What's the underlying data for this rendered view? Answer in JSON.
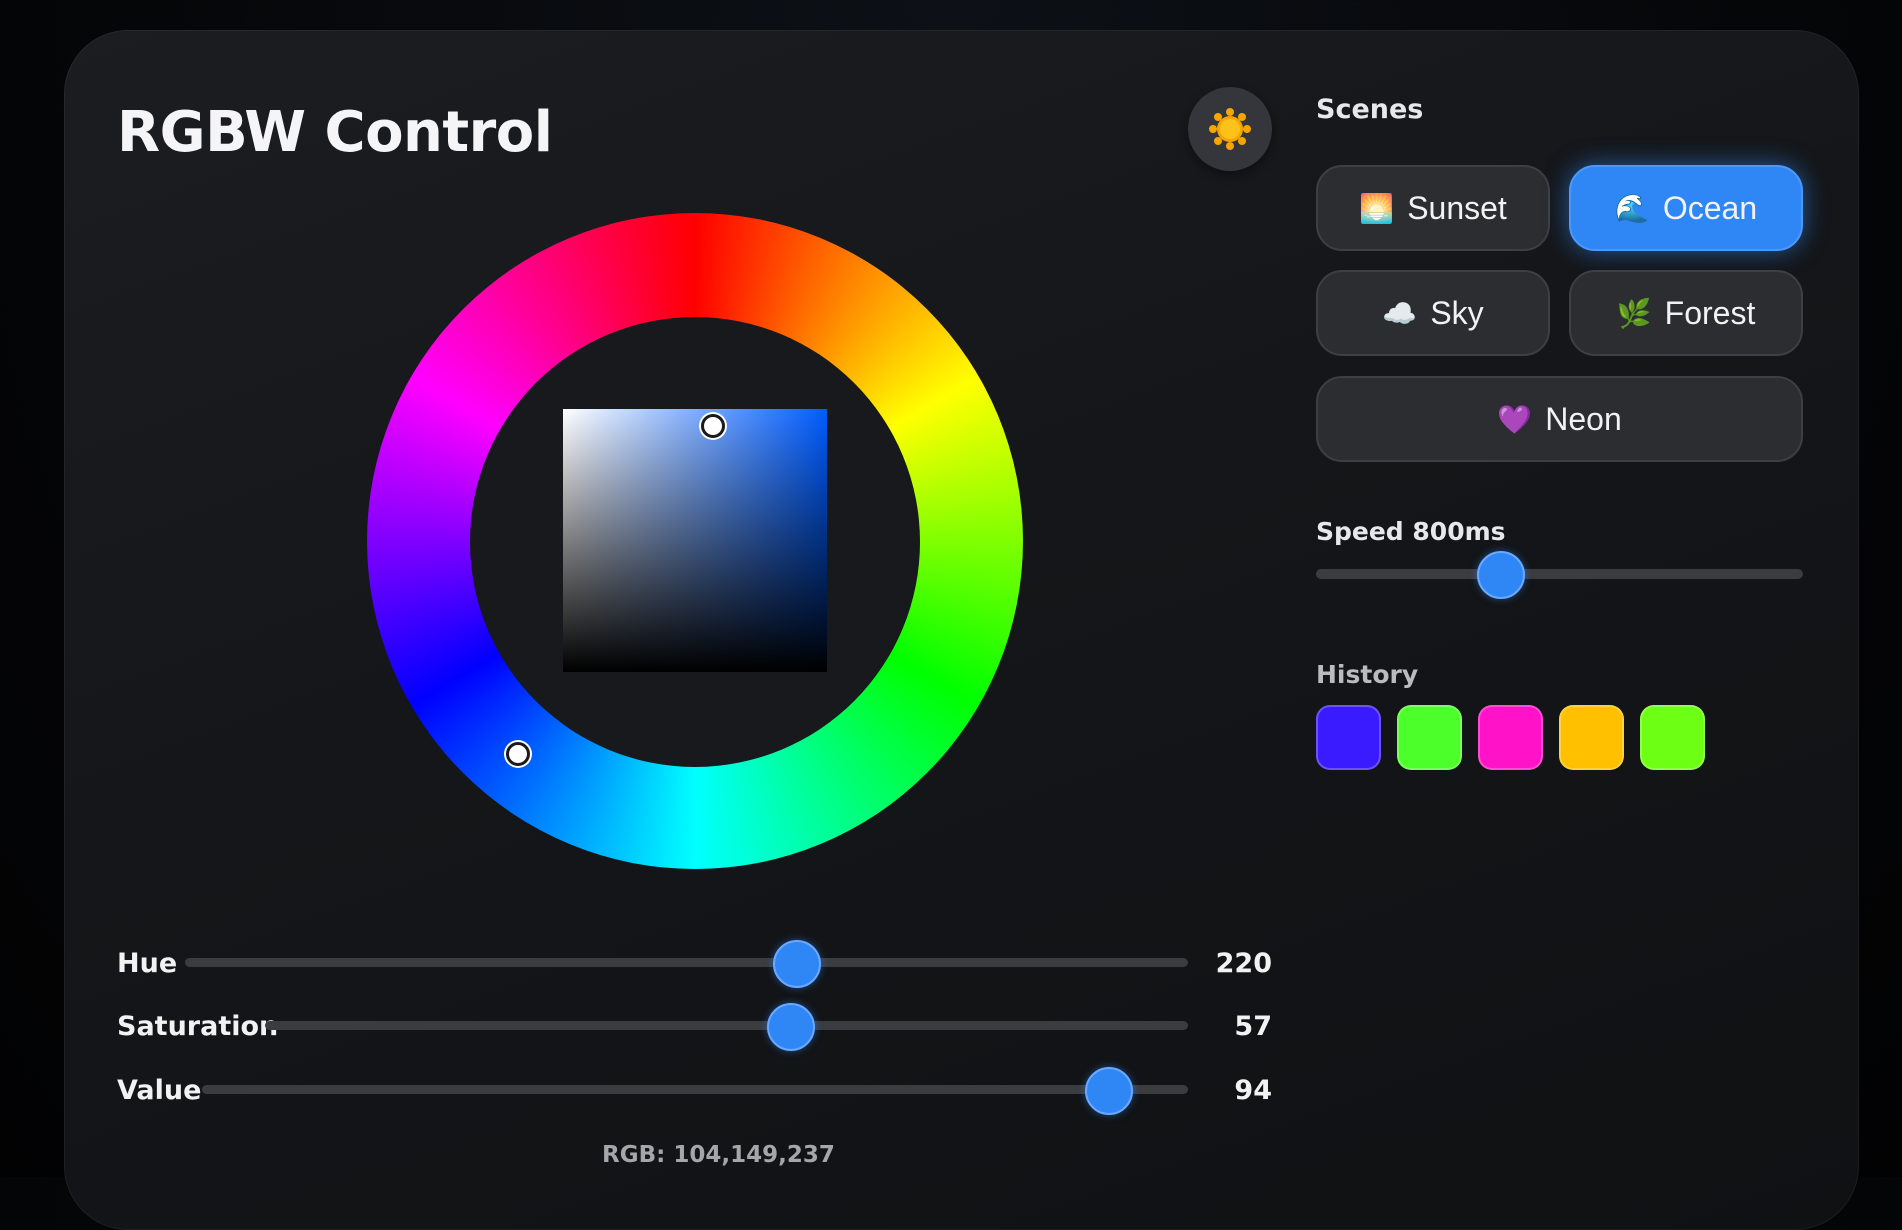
{
  "title": "RGBW Control",
  "theme_toggle_icon": "sun-icon",
  "sliders": [
    {
      "label": "Hue",
      "value": "220",
      "fraction": 0.61
    },
    {
      "label": "Saturation",
      "value": "57",
      "fraction": 0.57
    },
    {
      "label": "Value",
      "value": "94",
      "fraction": 0.92
    }
  ],
  "rgb_readout": "RGB: 104,149,237",
  "current_color": "#6895ed",
  "hue_color": "#005cff",
  "scenes": {
    "label": "Scenes",
    "items": [
      {
        "label": "Sunset",
        "icon": "🌅",
        "active": false
      },
      {
        "label": "Ocean",
        "icon": "🌊",
        "active": true
      },
      {
        "label": "Sky",
        "icon": "☁️",
        "active": false
      },
      {
        "label": "Forest",
        "icon": "🌿",
        "active": false
      },
      {
        "label": "Neon",
        "icon": "💜",
        "active": false
      }
    ]
  },
  "speed": {
    "label": "Speed 800ms",
    "fraction": 0.38
  },
  "history": {
    "label": "History",
    "colors": [
      "#3a1bff",
      "#4dff2a",
      "#ff12c8",
      "#ffc000",
      "#6dff14"
    ]
  },
  "accent_color": "#2f86f5"
}
